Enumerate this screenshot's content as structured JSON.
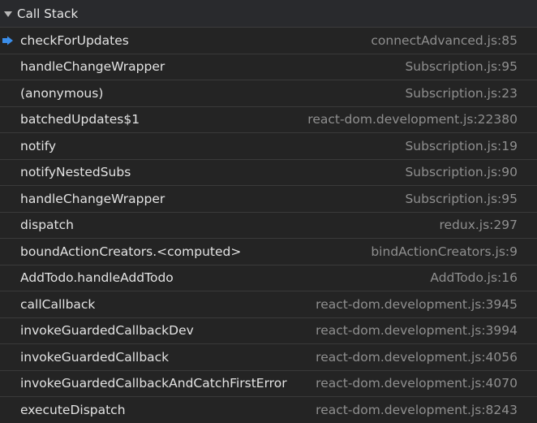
{
  "header": {
    "title": "Call Stack"
  },
  "colors": {
    "background": "#242424",
    "header_background": "#292a2d",
    "text": "#e3e3e3",
    "location_text": "#8f8f8f",
    "current_frame_arrow": "#3b8eea"
  },
  "current_frame_icon": "blue-arrow-icon",
  "frames": [
    {
      "name": "checkForUpdates",
      "location": "connectAdvanced.js:85",
      "current": true
    },
    {
      "name": "handleChangeWrapper",
      "location": "Subscription.js:95"
    },
    {
      "name": "(anonymous)",
      "location": "Subscription.js:23"
    },
    {
      "name": "batchedUpdates$1",
      "location": "react-dom.development.js:22380"
    },
    {
      "name": "notify",
      "location": "Subscription.js:19"
    },
    {
      "name": "notifyNestedSubs",
      "location": "Subscription.js:90"
    },
    {
      "name": "handleChangeWrapper",
      "location": "Subscription.js:95"
    },
    {
      "name": "dispatch",
      "location": "redux.js:297"
    },
    {
      "name": "boundActionCreators.<computed>",
      "location": "bindActionCreators.js:9"
    },
    {
      "name": "AddTodo.handleAddTodo",
      "location": "AddTodo.js:16"
    },
    {
      "name": "callCallback",
      "location": "react-dom.development.js:3945"
    },
    {
      "name": "invokeGuardedCallbackDev",
      "location": "react-dom.development.js:3994"
    },
    {
      "name": "invokeGuardedCallback",
      "location": "react-dom.development.js:4056"
    },
    {
      "name": "invokeGuardedCallbackAndCatchFirstError",
      "location": "react-dom.development.js:4070"
    },
    {
      "name": "executeDispatch",
      "location": "react-dom.development.js:8243"
    }
  ]
}
